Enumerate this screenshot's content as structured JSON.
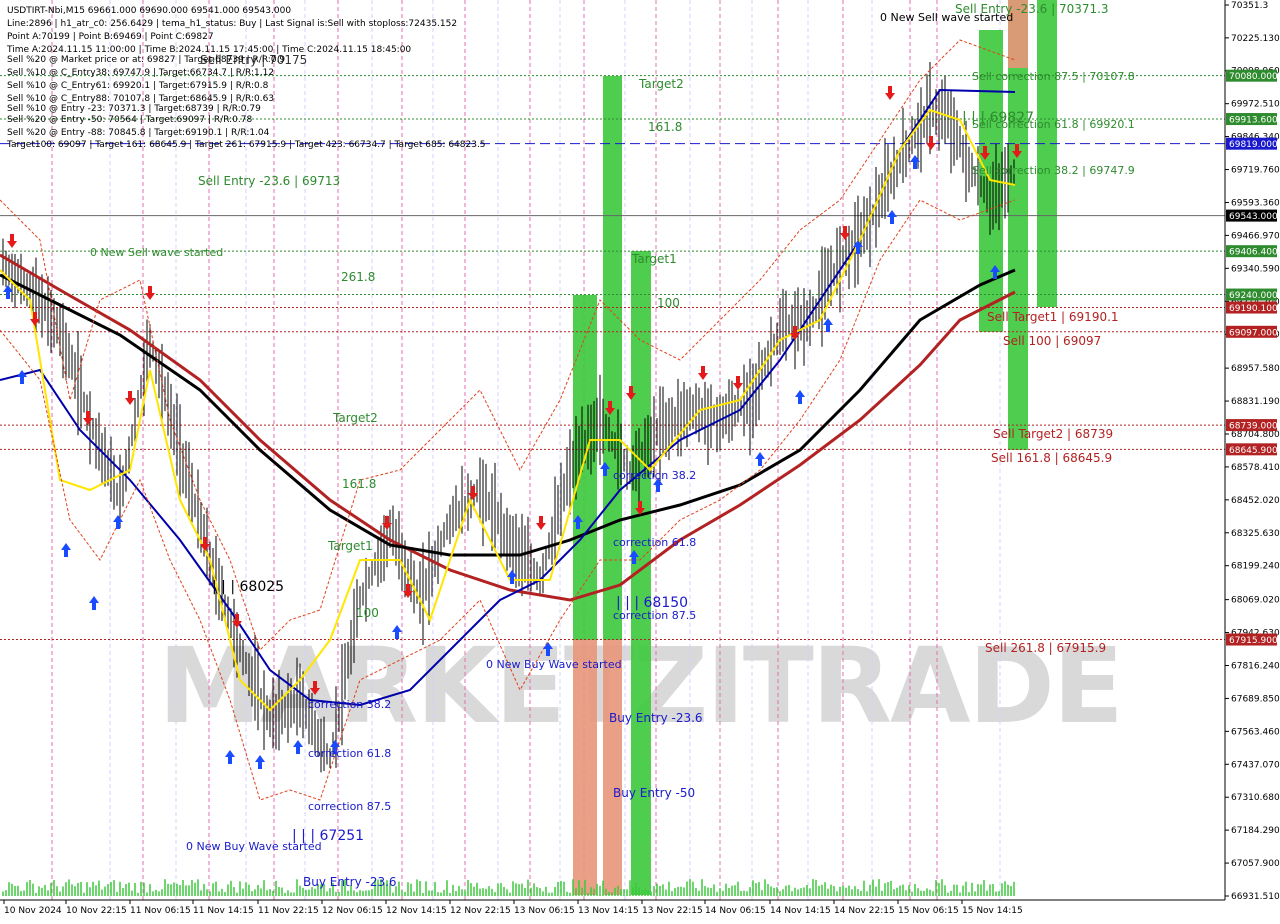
{
  "chart_data": {
    "type": "candlestick",
    "header_lines": [
      "USDTIRT-Nbi,M15  69661.000 69690.000 69541.000 69543.000",
      "Line:2896 | h1_atr_c0: 256.6429 | tema_h1_status: Buy | Last Signal is:Sell with stoploss:72435.152",
      "Point A:70199 | Point B:69469 | Point C:69827",
      "Time A:2024.11.15 11:00:00 | Time B:2024.11.15 17:45:00 | Time C:2024.11.15 18:45:00",
      "Sell %20 @ Market price or at: 69827 | Target:68739 | R/R:0.9",
      "Sell %10 @ C_Entry38: 69747.9 | Target:66734.7 | R/R:1.12",
      "Sell %10 @ C_Entry61: 69920.1 | Target:67915.9 | R/R:0.8",
      "Sell %10 @ C_Entry88: 70107.8 | Target:68645.9 | R/R:0.63",
      "Sell %10 @ Entry -23: 70371.3 | Target:68739 | R/R:0.79",
      "Sell %20 @ Entry -50: 70564 | Target:69097 | R/R:0.78",
      "Sell %20 @ Entry -88: 70845.8 | Target:69190.1 | R/R:1.04",
      "Target100: 69097 | Target 161: 68645.9 | Target 261: 67915.9 | Target 423: 66734.7 | Target 685: 64823.5"
    ],
    "watermark": "MARKETZITRADE",
    "y_ticks": [
      "70351.3",
      "70225.130",
      "70098.960",
      "69972.510",
      "69846.340",
      "69719.760",
      "69593.360",
      "69466.970",
      "69340.590",
      "69214.200",
      "69087.820",
      "68957.580",
      "68831.190",
      "68704.800",
      "68578.410",
      "68452.020",
      "68325.630",
      "68199.240",
      "68069.020",
      "67942.630",
      "67816.240",
      "67689.850",
      "67563.460",
      "67437.070",
      "67310.680",
      "67184.290",
      "67057.900",
      "66931.510"
    ],
    "ylim": [
      66931.51,
      70351.3
    ],
    "x_ticks": [
      "10 Nov 2024",
      "10 Nov 22:15",
      "11 Nov 06:15",
      "11 Nov 14:15",
      "11 Nov 22:15",
      "12 Nov 06:15",
      "12 Nov 14:15",
      "12 Nov 22:15",
      "13 Nov 06:15",
      "13 Nov 14:15",
      "13 Nov 22:15",
      "14 Nov 06:15",
      "14 Nov 14:15",
      "14 Nov 22:15",
      "15 Nov 06:15",
      "15 Nov 14:15"
    ],
    "price_badges": [
      {
        "label": "70080.000",
        "value": 70080,
        "color": "#2e8b2e"
      },
      {
        "label": "69913.600",
        "value": 69913.6,
        "color": "#2e8b2e"
      },
      {
        "label": "69819.000",
        "value": 69819,
        "color": "#1a1acc"
      },
      {
        "label": "69543.000",
        "value": 69543,
        "color": "#000000"
      },
      {
        "label": "69406.400",
        "value": 69406.4,
        "color": "#2e8b2e"
      },
      {
        "label": "69240.000",
        "value": 69240,
        "color": "#2e8b2e"
      },
      {
        "label": "69190.100",
        "value": 69190.1,
        "color": "#b22222"
      },
      {
        "label": "69097.000",
        "value": 69097,
        "color": "#b22222"
      },
      {
        "label": "68739.000",
        "value": 68739,
        "color": "#b22222"
      },
      {
        "label": "68645.900",
        "value": 68645.9,
        "color": "#b22222"
      },
      {
        "label": "67915.900",
        "value": 67915.9,
        "color": "#b22222"
      }
    ],
    "hlines": [
      {
        "value": 70080,
        "color": "#2e8b2e",
        "style": "dotted"
      },
      {
        "value": 69913.6,
        "color": "#2e8b2e",
        "style": "dotted"
      },
      {
        "value": 69819,
        "color": "#1a1acc",
        "style": "dashed"
      },
      {
        "value": 69543,
        "color": "#666666",
        "style": "solid"
      },
      {
        "value": 69406.4,
        "color": "#2e8b2e",
        "style": "dotted"
      },
      {
        "value": 69240,
        "color": "#2e8b2e",
        "style": "dotted"
      },
      {
        "value": 69190.1,
        "color": "#b22222",
        "style": "dotted"
      },
      {
        "value": 69097,
        "color": "#b22222",
        "style": "dotted"
      },
      {
        "value": 68739,
        "color": "#b22222",
        "style": "dotted"
      },
      {
        "value": 68645.9,
        "color": "#b22222",
        "style": "dotted"
      },
      {
        "value": 67915.9,
        "color": "#b22222",
        "style": "dotted"
      }
    ],
    "annotations": [
      {
        "text": "Sell Entry -23.6 | 70371.3",
        "color": "#2e8b2e",
        "anchor": "right"
      },
      {
        "text": "0 New Sell wave started",
        "color": "#000000"
      },
      {
        "text": "Sell correction 87.5 | 70107.8",
        "color": "#2e8b2e"
      },
      {
        "text": "| | | 69827",
        "color": "#2e8b2e"
      },
      {
        "text": "Sell correction 61.8 | 69920.1",
        "color": "#2e8b2e"
      },
      {
        "text": "Sell correction 38.2 | 69747.9",
        "color": "#2e8b2e"
      },
      {
        "text": "Sell Target1 | 69190.1",
        "color": "#b22222"
      },
      {
        "text": "Sell 100 | 69097",
        "color": "#b22222"
      },
      {
        "text": "Sell Target2 | 68739",
        "color": "#b22222"
      },
      {
        "text": "Sell 161.8 | 68645.9",
        "color": "#b22222"
      },
      {
        "text": "Sell 261.8 | 67915.9",
        "color": "#b22222"
      },
      {
        "text": "Sell Entry -23.6 | 69713",
        "color": "#2e8b2e"
      },
      {
        "text": "0 New Sell wave started",
        "color": "#2e8b2e"
      },
      {
        "text": "261.8",
        "color": "#2e8b2e"
      },
      {
        "text": "Target2",
        "color": "#2e8b2e"
      },
      {
        "text": "161.8",
        "color": "#2e8b2e"
      },
      {
        "text": "Target1",
        "color": "#2e8b2e"
      },
      {
        "text": "100",
        "color": "#2e8b2e"
      },
      {
        "text": "Target2",
        "color": "#2e8b2e"
      },
      {
        "text": "161.8",
        "color": "#2e8b2e"
      },
      {
        "text": "Target1",
        "color": "#2e8b2e"
      },
      {
        "text": "100",
        "color": "#2e8b2e"
      },
      {
        "text": "| | | 68025",
        "color": "#000000"
      },
      {
        "text": "correction 38.2",
        "color": "#1a1acc"
      },
      {
        "text": "correction 61.8",
        "color": "#1a1acc"
      },
      {
        "text": "correction 87.5",
        "color": "#1a1acc"
      },
      {
        "text": "0 New Buy Wave started",
        "color": "#1a1acc"
      },
      {
        "text": "| | | 67251",
        "color": "#1a1acc"
      },
      {
        "text": "Buy Entry -23.6",
        "color": "#1a1acc"
      },
      {
        "text": "0 New Buy Wave started",
        "color": "#1a1acc"
      },
      {
        "text": "correction 38.2",
        "color": "#1a1acc"
      },
      {
        "text": "correction 61.8",
        "color": "#1a1acc"
      },
      {
        "text": "| | | 68150",
        "color": "#1a1acc"
      },
      {
        "text": "correction 87.5",
        "color": "#1a1acc"
      },
      {
        "text": "Buy Entry -23.6",
        "color": "#1a1acc"
      },
      {
        "text": "Buy Entry -50",
        "color": "#1a1acc"
      },
      {
        "text": "Sell Entry | 70175",
        "color": "#000000"
      }
    ]
  }
}
